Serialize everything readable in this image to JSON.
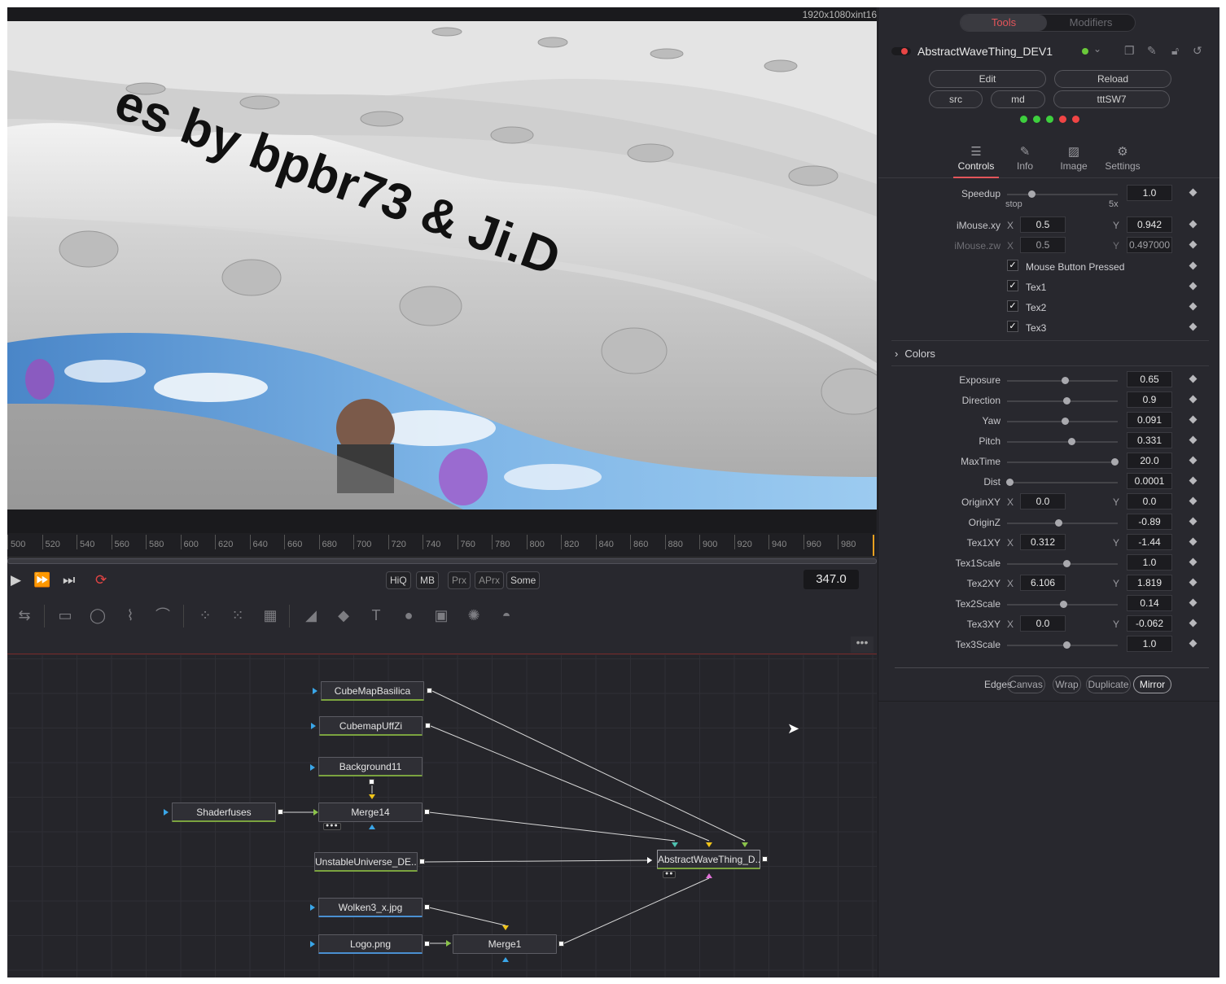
{
  "viewer": {
    "resolution": "1920x1080xint16",
    "banner_text": "es by bpbr73 & Ji.D"
  },
  "timeline": {
    "ticks": [
      "500",
      "520",
      "540",
      "560",
      "580",
      "600",
      "620",
      "640",
      "660",
      "680",
      "700",
      "720",
      "740",
      "760",
      "780",
      "800",
      "820",
      "840",
      "860",
      "880",
      "900",
      "920",
      "940",
      "960",
      "980"
    ],
    "current_frame": "347.0",
    "quality_buttons": [
      {
        "label": "HiQ",
        "dim": false
      },
      {
        "label": "MB",
        "dim": false
      },
      {
        "label": "Prx",
        "dim": true
      },
      {
        "label": "APrx",
        "dim": true
      },
      {
        "label": "Some",
        "dim": false
      }
    ]
  },
  "node_editor": {
    "more_label": "•••",
    "nodes": {
      "cubemap_basilica": "CubeMapBasilica",
      "cubemap_uffzi": "CubemapUffZi",
      "background11": "Background11",
      "shaderfuses": "Shaderfuses",
      "merge14": "Merge14",
      "unstable_universe": "UnstableUniverse_DE...",
      "abstract_wave": "AbstractWaveThing_D...",
      "wolken3": "Wolken3_x.jpg",
      "logo": "Logo.png",
      "merge1": "Merge1"
    },
    "dots_label": "●●",
    "dots_label2": "●●●"
  },
  "inspector": {
    "top_tabs": [
      "Tools",
      "Modifiers"
    ],
    "tool_name": "AbstractWaveThing_DEV1",
    "buttons": {
      "edit": "Edit",
      "reload": "Reload",
      "src": "src",
      "md": "md",
      "ttt": "tttSW7"
    },
    "status_dots": [
      "#3ecf3e",
      "#3ecf3e",
      "#3ecf3e",
      "#f04545",
      "#f04545"
    ],
    "tabs": [
      {
        "label": "Controls",
        "icon": "controls-icon",
        "active": true
      },
      {
        "label": "Info",
        "icon": "info-icon",
        "active": false
      },
      {
        "label": "Image",
        "icon": "image-icon",
        "active": false
      },
      {
        "label": "Settings",
        "icon": "settings-icon",
        "active": false
      }
    ],
    "speedup": {
      "label": "Speedup",
      "value": "1.0",
      "min_label": "stop",
      "max_label": "5x"
    },
    "imouse_xy": {
      "label": "iMouse.xy",
      "x_label": "X",
      "x": "0.5",
      "y_label": "Y",
      "y": "0.942"
    },
    "imouse_zw": {
      "label": "iMouse.zw",
      "x_label": "X",
      "x": "0.5",
      "y_label": "Y",
      "y": "0.497000"
    },
    "checkboxes": [
      "Mouse Button Pressed",
      "Tex1",
      "Tex2",
      "Tex3"
    ],
    "colors_section": "Colors",
    "sliders": [
      {
        "label": "Exposure",
        "value": "0.65",
        "knob": 0.52
      },
      {
        "label": "Direction",
        "value": "0.9",
        "knob": 0.54
      },
      {
        "label": "Yaw",
        "value": "0.091",
        "knob": 0.52
      },
      {
        "label": "Pitch",
        "value": "0.331",
        "knob": 0.58
      },
      {
        "label": "MaxTime",
        "value": "20.0",
        "knob": 0.97
      },
      {
        "label": "Dist",
        "value": "0.0001",
        "knob": 0.02
      }
    ],
    "origin_xy": {
      "label": "OriginXY",
      "x_label": "X",
      "x": "0.0",
      "y_label": "Y",
      "y": "0.0"
    },
    "origin_z": {
      "label": "OriginZ",
      "value": "-0.89",
      "knob": 0.46
    },
    "tex1_xy": {
      "label": "Tex1XY",
      "x_label": "X",
      "x": "0.312",
      "y_label": "Y",
      "y": "-1.44"
    },
    "tex1_scale": {
      "label": "Tex1Scale",
      "value": "1.0",
      "knob": 0.54
    },
    "tex2_xy": {
      "label": "Tex2XY",
      "x_label": "X",
      "x": "6.106",
      "y_label": "Y",
      "y": "1.819"
    },
    "tex2_scale": {
      "label": "Tex2Scale",
      "value": "0.14",
      "knob": 0.51
    },
    "tex3_xy": {
      "label": "Tex3XY",
      "x_label": "X",
      "x": "0.0",
      "y_label": "Y",
      "y": "-0.062"
    },
    "tex3_scale": {
      "label": "Tex3Scale",
      "value": "1.0",
      "knob": 0.54
    },
    "edges": {
      "label": "Edges",
      "options": [
        "Canvas",
        "Wrap",
        "Duplicate",
        "Mirror"
      ],
      "selected": "Mirror"
    }
  }
}
